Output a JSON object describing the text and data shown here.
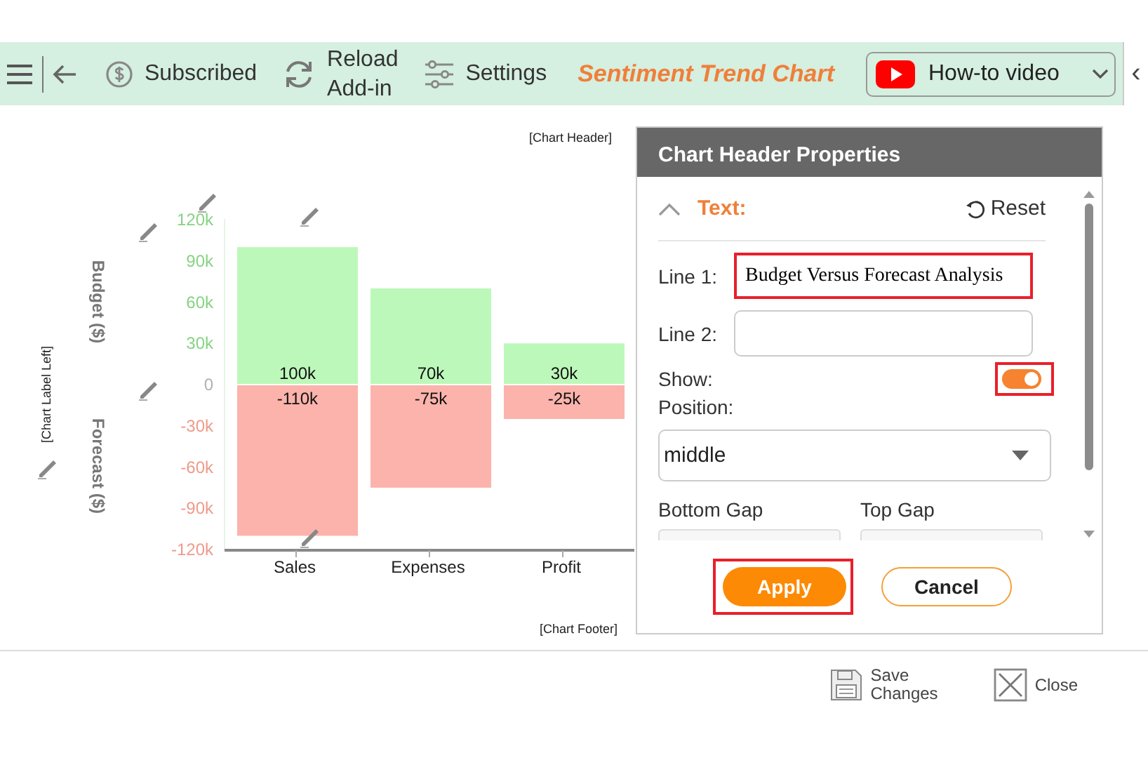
{
  "toolbar": {
    "items": [
      {
        "kind": "subscribed",
        "label": "Subscribed"
      },
      {
        "kind": "reload",
        "label": "Reload Add-in"
      },
      {
        "kind": "settings",
        "label": "Settings"
      }
    ],
    "title": "Sentiment Trend Chart",
    "video": {
      "label": "How-to video"
    },
    "collapse": "‹"
  },
  "chart": {
    "header_placeholder": "[Chart Header]",
    "footer_placeholder": "[Chart Footer]",
    "left_label_placeholder": "[Chart Label Left]",
    "axis_titles": [
      "Budget ($)",
      "Forecast ($)"
    ],
    "chart_data": {
      "type": "bar",
      "stacked": true,
      "categories": [
        "Sales",
        "Expenses",
        "Profit"
      ],
      "series": [
        {
          "color": "#bdf8bb",
          "values": [
            100000,
            70000,
            30000
          ]
        },
        {
          "color": "#fbb3ab",
          "values": [
            -110000,
            -75000,
            -25000
          ]
        }
      ],
      "ylim": [
        -120000,
        120000
      ],
      "yticks": [
        {
          "value": 120000,
          "label": "120k"
        },
        {
          "value": 90000,
          "label": "90k"
        },
        {
          "value": 60000,
          "label": "60k"
        },
        {
          "value": 30000,
          "label": "30k"
        },
        {
          "value": 0,
          "label": "0"
        },
        {
          "value": -30000,
          "label": "-30k"
        },
        {
          "value": -60000,
          "label": "-60k"
        },
        {
          "value": -90000,
          "label": "-90k"
        },
        {
          "value": -120000,
          "label": "-120k"
        }
      ],
      "value_labels": [
        [
          "100k",
          "70k",
          "30k"
        ],
        [
          "-110k",
          "-75k",
          "-25k"
        ]
      ]
    }
  },
  "panel": {
    "title": "Chart Header Properties",
    "section": {
      "label": "Text:",
      "expanded": true
    },
    "reset": "Reset",
    "line1": {
      "label": "Line 1:",
      "value": "Budget Versus Forecast Analysis"
    },
    "line2": {
      "label": "Line 2:"
    },
    "show": {
      "label": "Show:",
      "on": true
    },
    "position": {
      "label": "Position:",
      "value": "middle"
    },
    "gaps": [
      "Bottom Gap",
      "Top Gap"
    ],
    "apply": "Apply",
    "cancel": "Cancel"
  },
  "footer": {
    "save": "Save Changes",
    "close": "Close"
  }
}
